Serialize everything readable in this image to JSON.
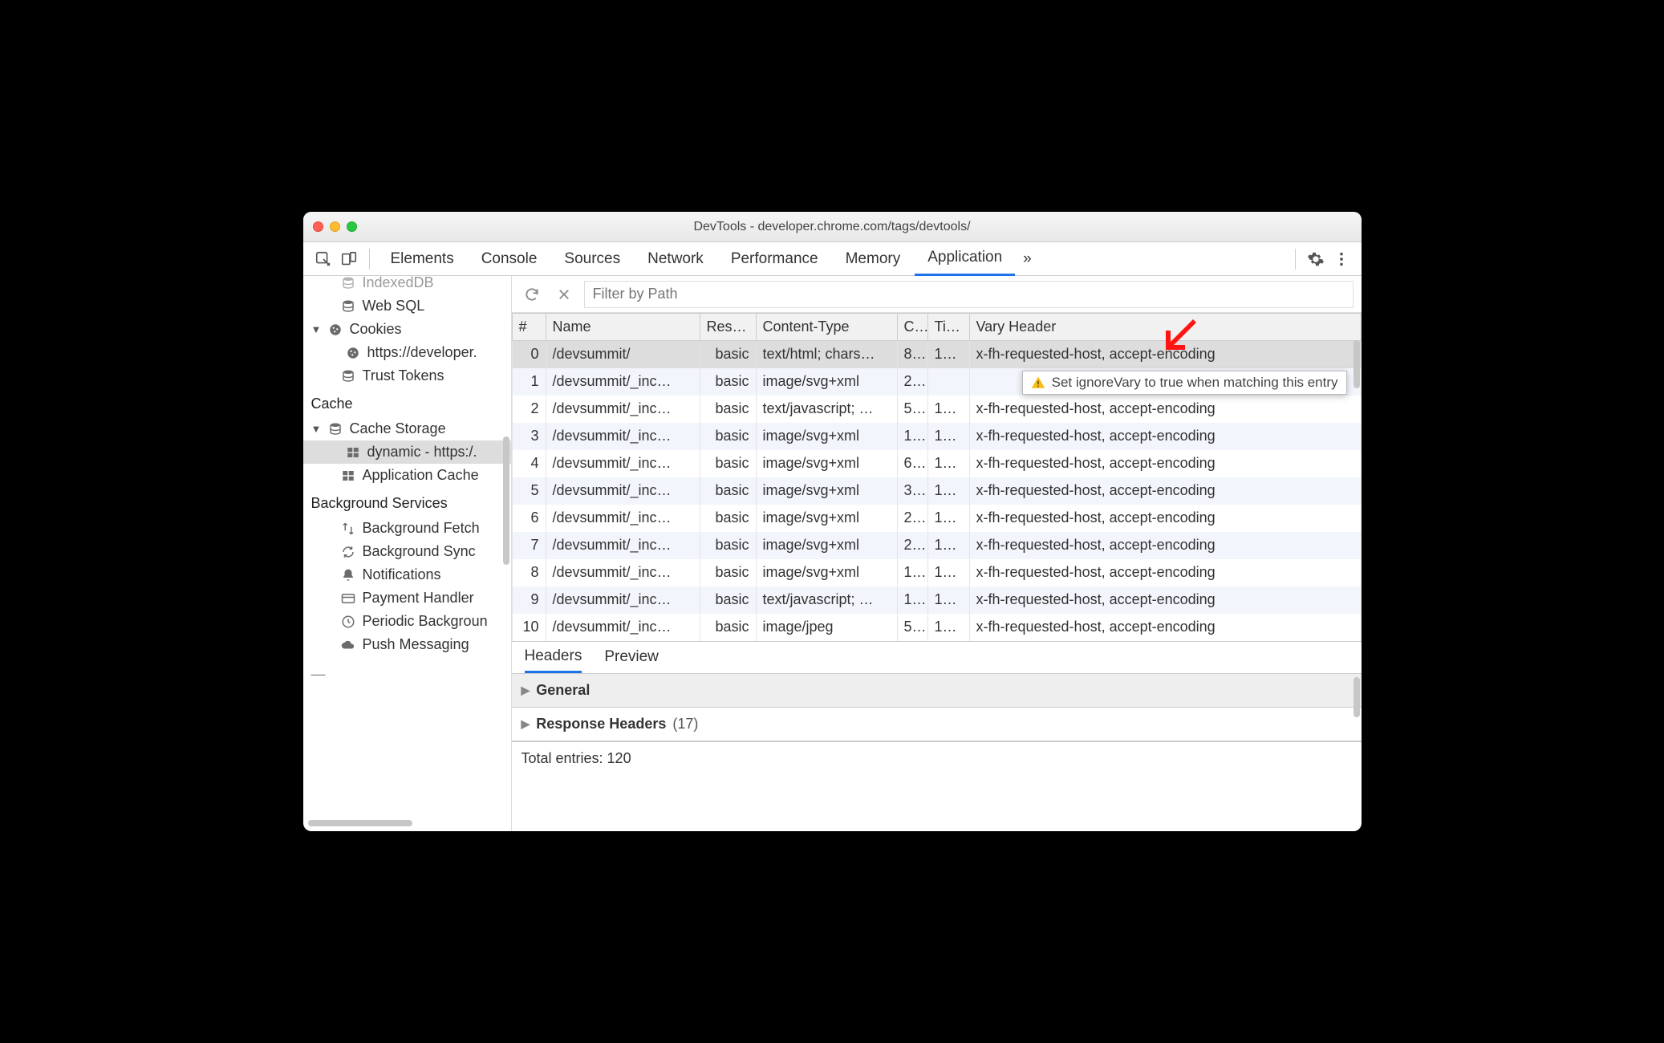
{
  "window": {
    "title": "DevTools - developer.chrome.com/tags/devtools/"
  },
  "tabs": {
    "items": [
      "Elements",
      "Console",
      "Sources",
      "Network",
      "Performance",
      "Memory",
      "Application"
    ],
    "active": "Application",
    "overflow": "»"
  },
  "sidebar": {
    "top_truncated": "IndexedDB",
    "websql": "Web SQL",
    "cookies": "Cookies",
    "cookies_child": "https://developer.",
    "trust_tokens": "Trust Tokens",
    "sections": {
      "cache": "Cache",
      "bg": "Background Services"
    },
    "cache_storage": "Cache Storage",
    "cache_dynamic": "dynamic - https:/.",
    "app_cache": "Application Cache",
    "bg_items": [
      "Background Fetch",
      "Background Sync",
      "Notifications",
      "Payment Handler",
      "Periodic Backgroun",
      "Push Messaging"
    ]
  },
  "toolbar": {
    "filter_placeholder": "Filter by Path"
  },
  "table": {
    "columns": [
      "#",
      "Name",
      "Res…",
      "Content-Type",
      "C..",
      "Ti…",
      "Vary Header"
    ],
    "rows": [
      {
        "idx": "0",
        "name": "/devsummit/",
        "resp": "basic",
        "type": "text/html; chars…",
        "c": "8…",
        "t": "1…",
        "vary": "x-fh-requested-host, accept-encoding",
        "selected": true
      },
      {
        "idx": "1",
        "name": "/devsummit/_inc…",
        "resp": "basic",
        "type": "image/svg+xml",
        "c": "2…",
        "t": "",
        "vary": ""
      },
      {
        "idx": "2",
        "name": "/devsummit/_inc…",
        "resp": "basic",
        "type": "text/javascript; …",
        "c": "5…",
        "t": "1…",
        "vary": "x-fh-requested-host, accept-encoding"
      },
      {
        "idx": "3",
        "name": "/devsummit/_inc…",
        "resp": "basic",
        "type": "image/svg+xml",
        "c": "1…",
        "t": "1…",
        "vary": "x-fh-requested-host, accept-encoding"
      },
      {
        "idx": "4",
        "name": "/devsummit/_inc…",
        "resp": "basic",
        "type": "image/svg+xml",
        "c": "6…",
        "t": "1…",
        "vary": "x-fh-requested-host, accept-encoding"
      },
      {
        "idx": "5",
        "name": "/devsummit/_inc…",
        "resp": "basic",
        "type": "image/svg+xml",
        "c": "3…",
        "t": "1…",
        "vary": "x-fh-requested-host, accept-encoding"
      },
      {
        "idx": "6",
        "name": "/devsummit/_inc…",
        "resp": "basic",
        "type": "image/svg+xml",
        "c": "2…",
        "t": "1…",
        "vary": "x-fh-requested-host, accept-encoding"
      },
      {
        "idx": "7",
        "name": "/devsummit/_inc…",
        "resp": "basic",
        "type": "image/svg+xml",
        "c": "2…",
        "t": "1…",
        "vary": "x-fh-requested-host, accept-encoding"
      },
      {
        "idx": "8",
        "name": "/devsummit/_inc…",
        "resp": "basic",
        "type": "image/svg+xml",
        "c": "1…",
        "t": "1…",
        "vary": "x-fh-requested-host, accept-encoding"
      },
      {
        "idx": "9",
        "name": "/devsummit/_inc…",
        "resp": "basic",
        "type": "text/javascript; …",
        "c": "1…",
        "t": "1…",
        "vary": "x-fh-requested-host, accept-encoding"
      },
      {
        "idx": "10",
        "name": "/devsummit/_inc…",
        "resp": "basic",
        "type": "image/jpeg",
        "c": "5…",
        "t": "1…",
        "vary": "x-fh-requested-host, accept-encoding"
      }
    ]
  },
  "tooltip": {
    "text": "Set ignoreVary to true when matching this entry"
  },
  "detail": {
    "tabs": [
      "Headers",
      "Preview"
    ],
    "active": "Headers",
    "general": "General",
    "response_headers": "Response Headers",
    "response_headers_count": "(17)",
    "footer": "Total entries: 120"
  }
}
